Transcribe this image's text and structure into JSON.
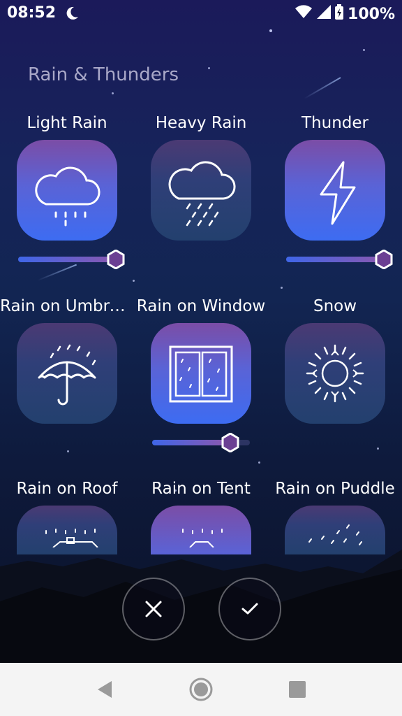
{
  "status_bar": {
    "time": "08:52",
    "battery": "100%",
    "icons": [
      "moon-icon",
      "wifi-icon",
      "signal-icon",
      "battery-icon"
    ]
  },
  "section_title": "Rain & Thunders",
  "sounds": [
    {
      "label": "Light Rain",
      "active": true,
      "icon": "light-rain-icon",
      "volume": 0.9
    },
    {
      "label": "Heavy Rain",
      "active": false,
      "icon": "heavy-rain-icon"
    },
    {
      "label": "Thunder",
      "active": true,
      "icon": "lightning-icon",
      "volume": 0.9
    },
    {
      "label": "Rain on Umbrel...",
      "active": false,
      "icon": "umbrella-icon"
    },
    {
      "label": "Rain on Window",
      "active": true,
      "icon": "window-icon",
      "volume": 0.75
    },
    {
      "label": "Snow",
      "active": false,
      "icon": "snowflake-icon"
    },
    {
      "label": "Rain on Roof",
      "active": false,
      "icon": "roof-icon"
    },
    {
      "label": "Rain on Tent",
      "active": false,
      "icon": "tent-icon"
    },
    {
      "label": "Rain on Puddle",
      "active": false,
      "icon": "puddle-icon"
    }
  ],
  "actions": {
    "cancel_icon": "close-icon",
    "confirm_icon": "check-icon"
  },
  "nav": {
    "back": "back-icon",
    "home": "home-icon",
    "recents": "recents-icon"
  },
  "colors": {
    "accent": "#3d6cf2",
    "tile_top": "#7b4da6",
    "thumb": "#6b3f93"
  }
}
